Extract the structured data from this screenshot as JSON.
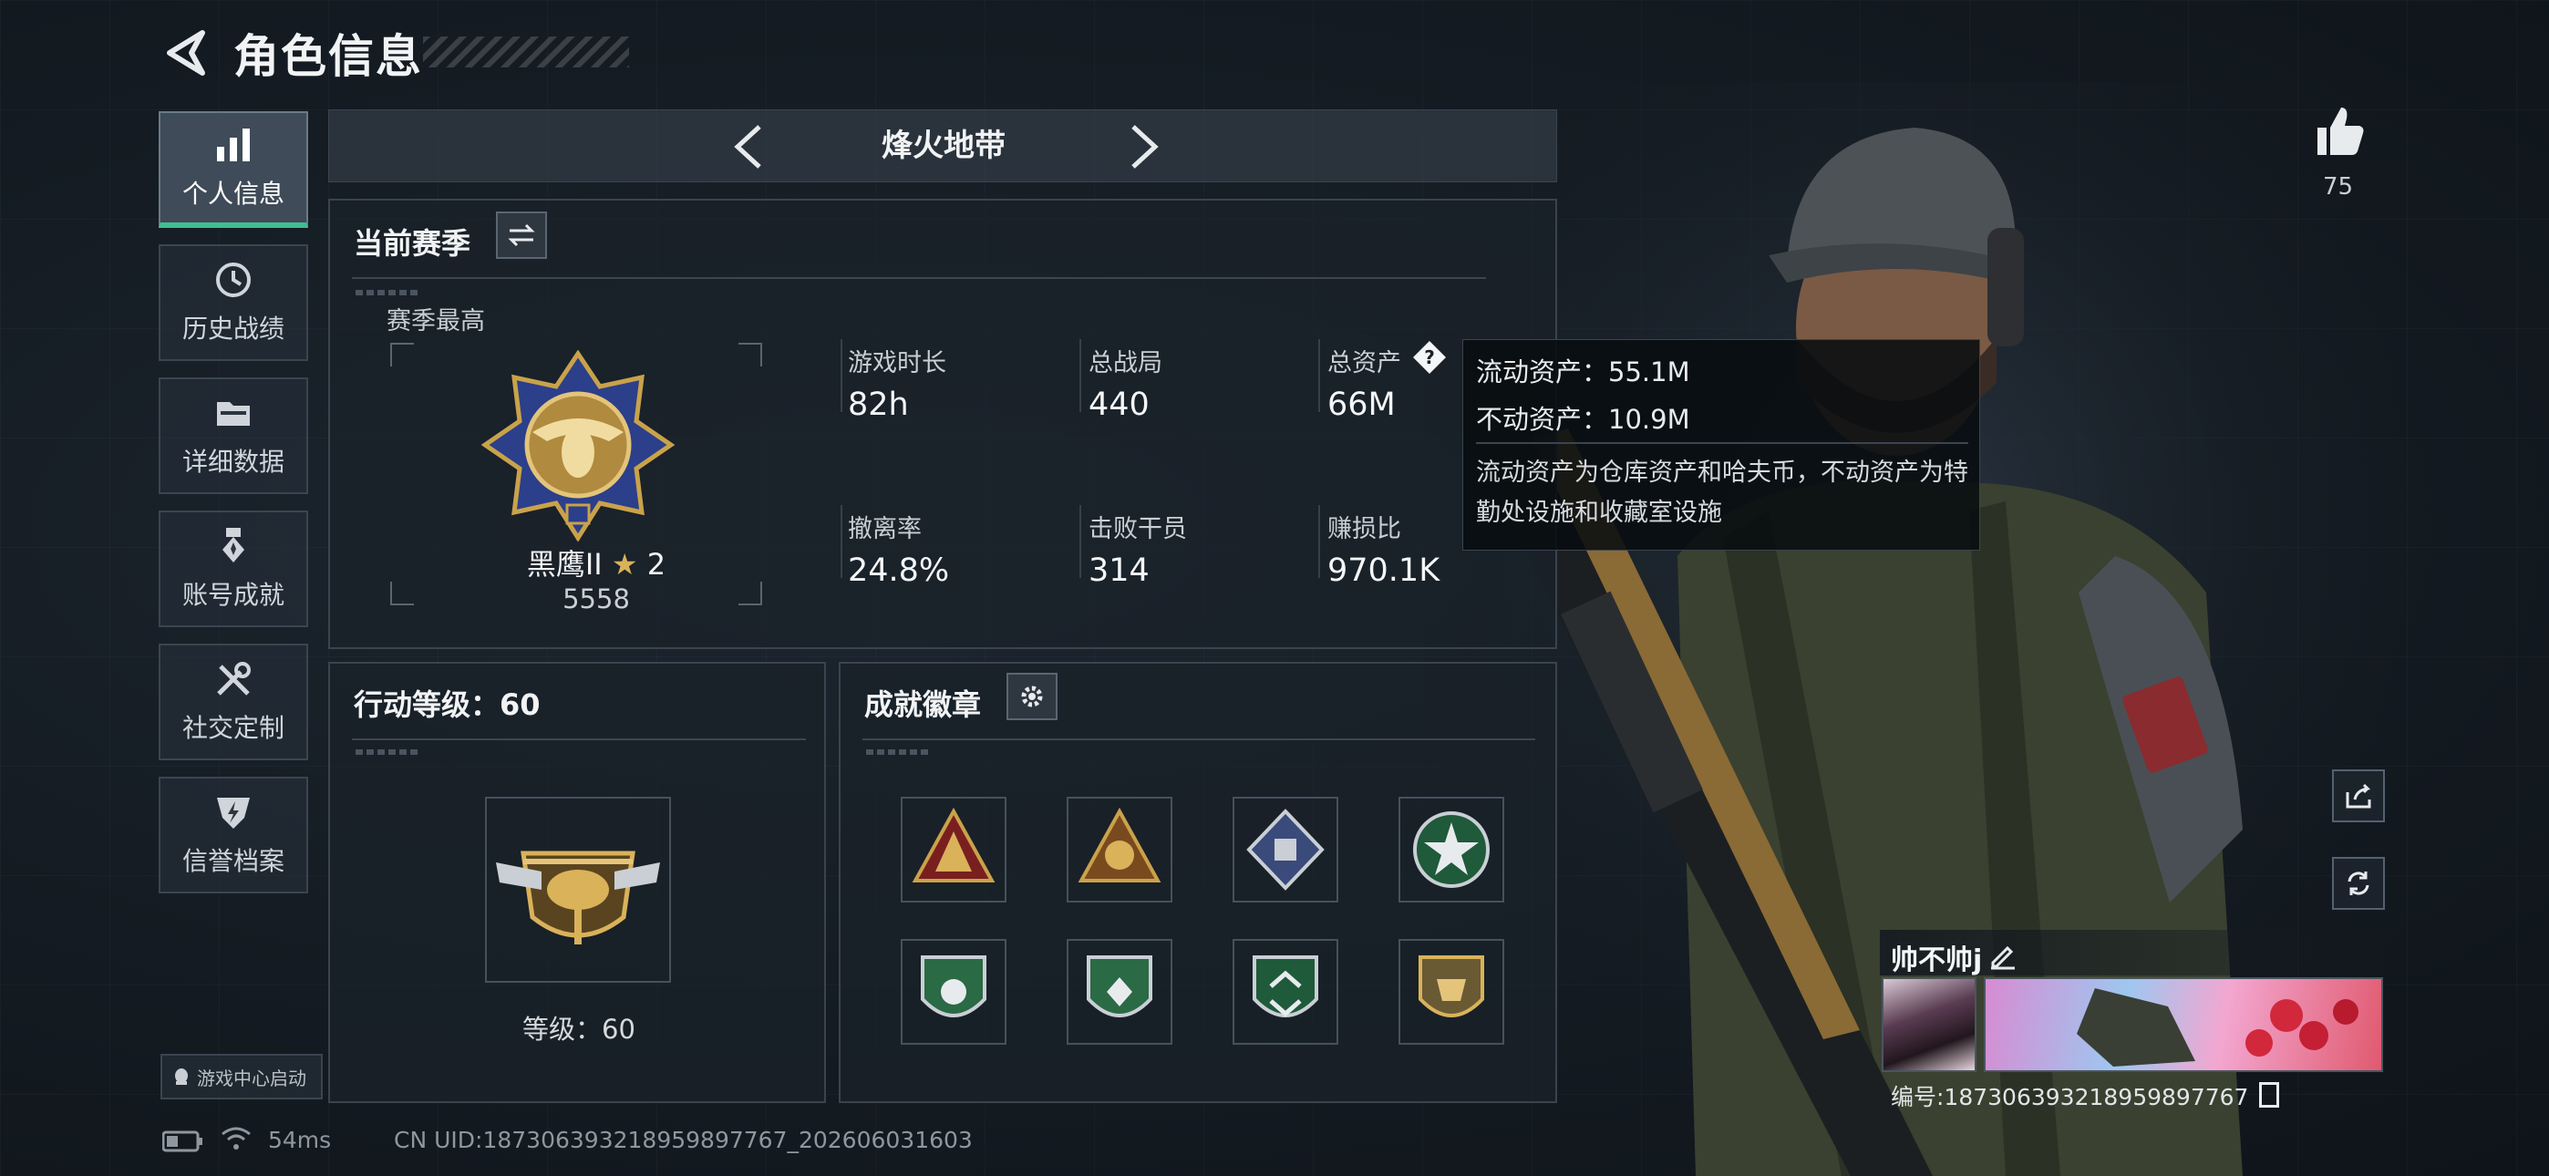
{
  "header": {
    "title": "角色信息"
  },
  "sidebar": {
    "items": [
      {
        "label": "个人信息",
        "icon": "bar-chart-icon",
        "active": true
      },
      {
        "label": "历史战绩",
        "icon": "history-icon"
      },
      {
        "label": "详细数据",
        "icon": "folder-icon"
      },
      {
        "label": "账号成就",
        "icon": "medal-icon"
      },
      {
        "label": "社交定制",
        "icon": "tools-icon"
      },
      {
        "label": "信誉档案",
        "icon": "shield-bolt-icon"
      }
    ],
    "game_center": "游戏中心启动"
  },
  "mode_bar": {
    "name": "烽火地带"
  },
  "season": {
    "title": "当前赛季",
    "subtitle": "赛季最高",
    "rank_name": "黑鹰II",
    "rank_stars": "2",
    "rank_score": "5558",
    "stats": [
      {
        "label": "游戏时长",
        "value": "82h"
      },
      {
        "label": "总战局",
        "value": "440"
      },
      {
        "label": "总资产",
        "value": "66M"
      },
      {
        "label": "撤离率",
        "value": "24.8%"
      },
      {
        "label": "击败干员",
        "value": "314"
      },
      {
        "label": "赚损比",
        "value": "970.1K"
      }
    ]
  },
  "tooltip": {
    "liquid": "流动资产：55.1M",
    "fixed": "不动资产：10.9M",
    "desc": "流动资产为仓库资产和哈夫币，不动资产为特勤处设施和收藏室设施"
  },
  "action_level": {
    "title": "行动等级：60",
    "level_text": "等级：60"
  },
  "badges": {
    "title": "成就徽章",
    "items": [
      "triangle-badge-icon",
      "triangle-badge-icon",
      "diamond-badge-icon",
      "star-badge-icon",
      "shield-badge-icon",
      "shield-badge-icon",
      "shield-badge-icon",
      "shield-badge-icon"
    ]
  },
  "right": {
    "like_count": "75",
    "player_name": "帅不帅j",
    "player_id": "编号:187306393218959897767"
  },
  "footer": {
    "ping": "54ms",
    "uid": "CN UID:187306393218959897767_202606031603"
  },
  "colors": {
    "accent": "#3fbf8f",
    "panel_border": "#3a444e",
    "gold": "#c9a24a"
  }
}
